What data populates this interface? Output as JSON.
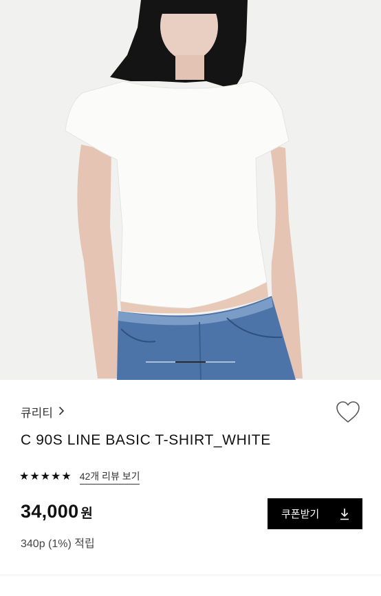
{
  "product": {
    "brand": "큐리티",
    "title": "C 90S LINE BASIC T-SHIRT_WHITE",
    "rating_stars": 5,
    "review_link": "42개 리뷰 보기",
    "price": "34,000",
    "currency": "원",
    "points": "340p (1%) 적립"
  },
  "gallery": {
    "current_slide_fraction": 0.33
  },
  "actions": {
    "coupon_label": "쿠폰받기"
  },
  "icons": {
    "brand_chevron": "chevron-right-icon",
    "wishlist": "heart-outline-icon",
    "coupon": "download-icon",
    "star": "star-filled-icon"
  },
  "colors": {
    "button_bg": "#000000",
    "text_primary": "#111111",
    "text_secondary": "#444444"
  }
}
